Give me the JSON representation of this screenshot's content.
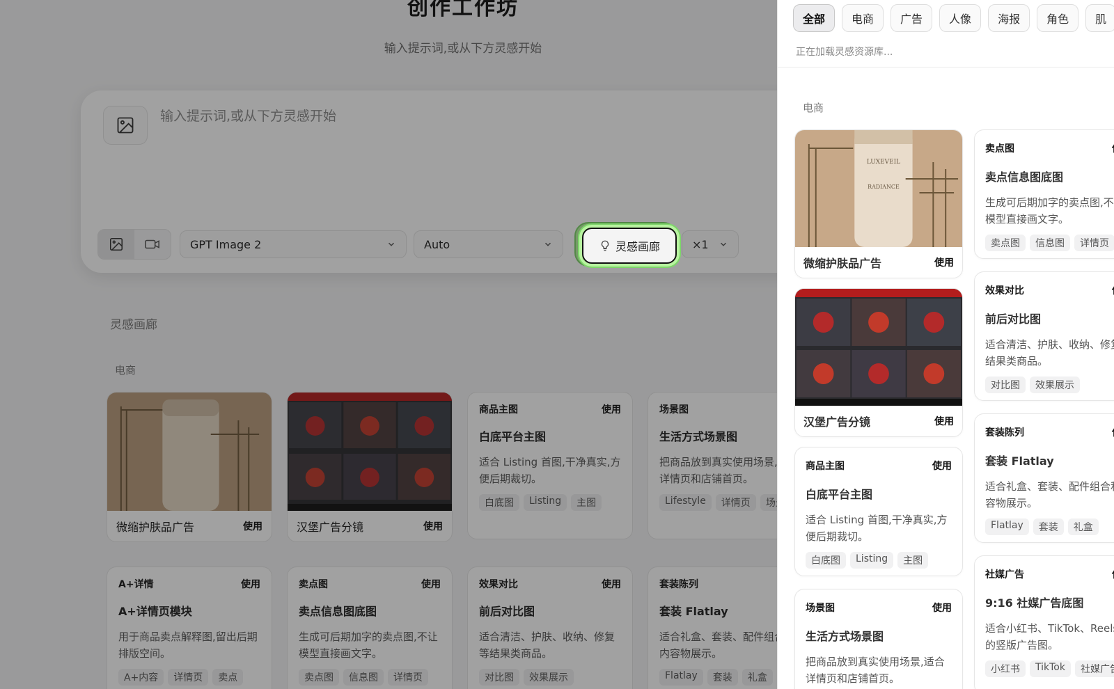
{
  "page": {
    "title": "创作工作坊",
    "subtitle": "输入提示词,或从下方灵感开始"
  },
  "composer": {
    "prompt_placeholder": "输入提示词,或从下方灵感开始",
    "model": "GPT Image 2",
    "ratio": "Auto",
    "gallery_button": "灵感画廊",
    "count": "×1"
  },
  "gallery": {
    "heading": "灵感画廊",
    "category": "电商",
    "image_cards": [
      {
        "name": "微缩护肤品广告",
        "action": "使用"
      },
      {
        "name": "汉堡广告分镜",
        "action": "使用"
      }
    ],
    "text_cards": [
      {
        "category": "商品主图",
        "action": "使用",
        "name": "白底平台主图",
        "desc": "适合 Listing 首图,干净真实,方便后期裁切。",
        "tags": [
          "白底图",
          "Listing",
          "主图"
        ]
      },
      {
        "category": "场景图",
        "action": "使用",
        "name": "生活方式场景图",
        "desc": "把商品放到真实使用场景,适合详情页和店铺首页。",
        "tags": [
          "Lifestyle",
          "详情页",
          "场景图"
        ]
      },
      {
        "category": "A+详情",
        "action": "使用",
        "name": "A+详情页模块",
        "desc": "用于商品卖点解释图,留出后期排版空间。",
        "tags": [
          "A+内容",
          "详情页",
          "卖点"
        ]
      },
      {
        "category": "卖点图",
        "action": "使用",
        "name": "卖点信息图底图",
        "desc": "生成可后期加字的卖点图,不让模型直接画文字。",
        "tags": [
          "卖点图",
          "信息图",
          "详情页"
        ]
      },
      {
        "category": "效果对比",
        "action": "使用",
        "name": "前后对比图",
        "desc": "适合清洁、护肤、收纳、修复等结果类商品。",
        "tags": [
          "对比图",
          "效果展示"
        ]
      },
      {
        "category": "套装陈列",
        "action": "使用",
        "name": "套装 Flatlay",
        "desc": "适合礼盒、套装、配件组合和内容物展示。",
        "tags": [
          "Flatlay",
          "套装",
          "礼盒"
        ]
      }
    ]
  },
  "drawer": {
    "tabs": [
      "全部",
      "电商",
      "广告",
      "人像",
      "海报",
      "角色",
      "肌"
    ],
    "loading": "正在加载灵感资源库...",
    "section": "电商",
    "left_column": {
      "image_cards": [
        {
          "name": "微缩护肤品广告",
          "action": "使用"
        },
        {
          "name": "汉堡广告分镜",
          "action": "使用"
        }
      ],
      "text_cards": [
        {
          "category": "商品主图",
          "action": "使用",
          "name": "白底平台主图",
          "desc": "适合 Listing 首图,干净真实,方便后期裁切。",
          "tags": [
            "白底图",
            "Listing",
            "主图"
          ]
        },
        {
          "category": "场景图",
          "action": "使用",
          "name": "生活方式场景图",
          "desc": "把商品放到真实使用场景,适合详情页和店铺首页。",
          "tags": []
        }
      ]
    },
    "right_column": [
      {
        "category": "卖点图",
        "action": "使用",
        "name": "卖点信息图底图",
        "desc": "生成可后期加字的卖点图,不让模型直接画文字。",
        "tags": [
          "卖点图",
          "信息图",
          "详情页"
        ]
      },
      {
        "category": "效果对比",
        "action": "使用",
        "name": "前后对比图",
        "desc": "适合清洁、护肤、收纳、修复等结果类商品。",
        "tags": [
          "对比图",
          "效果展示"
        ]
      },
      {
        "category": "套装陈列",
        "action": "使用",
        "name": "套装 Flatlay",
        "desc": "适合礼盒、套装、配件组合和内容物展示。",
        "tags": [
          "Flatlay",
          "套装",
          "礼盒"
        ]
      },
      {
        "category": "社媒广告",
        "action": "使用",
        "name": "9:16 社媒广告底图",
        "desc": "适合小红书、TikTok、Reels 的竖版广告图。",
        "tags": [
          "小红书",
          "TikTok",
          "社媒广告"
        ]
      }
    ]
  },
  "colors": {
    "accent_glow": "#7ed66a",
    "overlay": "#141414"
  }
}
